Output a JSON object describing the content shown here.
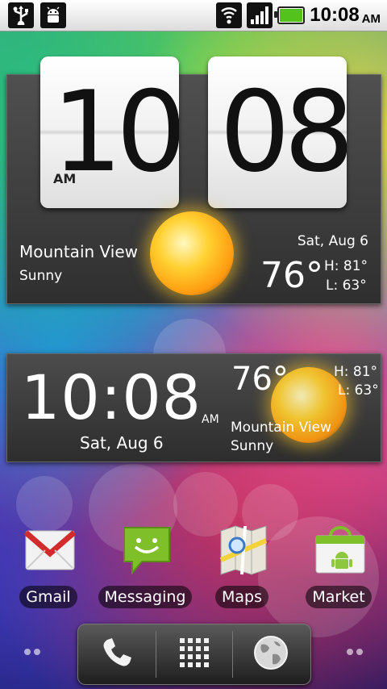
{
  "status_bar": {
    "time": "10:08",
    "ampm": "AM",
    "icons": [
      "usb-icon",
      "android-debug-icon",
      "wifi-icon",
      "signal-icon",
      "battery-icon"
    ]
  },
  "flip_clock_widget": {
    "hour": "10",
    "minute": "08",
    "ampm": "AM",
    "city": "Mountain View",
    "condition": "Sunny",
    "date": "Sat, Aug 6",
    "temperature": "76°",
    "high": "H:  81°",
    "low": "L:  63°",
    "weather_icon": "sun-icon"
  },
  "digital_clock_widget": {
    "time": "10:08",
    "ampm": "AM",
    "date": "Sat, Aug 6",
    "temperature": "76°",
    "high": "H: 81°",
    "low": "L: 63°",
    "city": "Mountain View",
    "condition": "Sunny",
    "weather_icon": "sun-icon"
  },
  "apps": [
    {
      "label": "Gmail",
      "icon": "gmail-icon"
    },
    {
      "label": "Messaging",
      "icon": "messaging-icon"
    },
    {
      "label": "Maps",
      "icon": "maps-icon"
    },
    {
      "label": "Market",
      "icon": "market-icon"
    }
  ],
  "dock": {
    "buttons": [
      "phone-icon",
      "app-drawer-icon",
      "browser-icon"
    ]
  },
  "colors": {
    "status_bar_bg": "#ffffff",
    "battery_green": "#54c21c",
    "widget_bg": "#3e3e3e",
    "gmail_red": "#d22b2b",
    "messaging_green": "#7fbf2a"
  }
}
